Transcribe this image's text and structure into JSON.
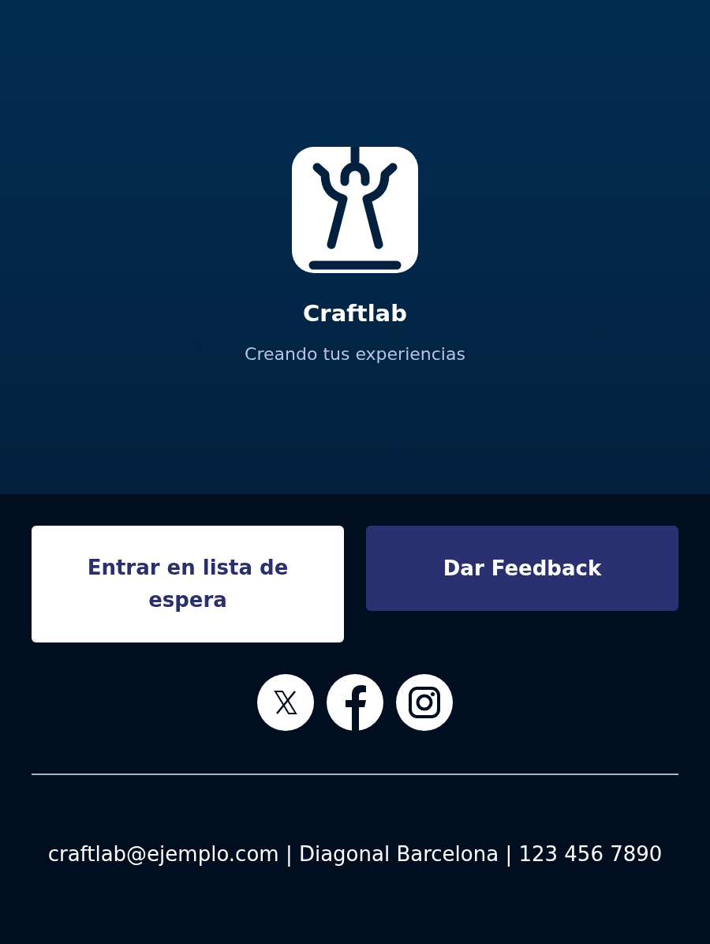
{
  "brand": {
    "name": "Craftlab",
    "tagline": "Creando tus experiencias"
  },
  "buttons": [
    {
      "label": "Entrar en lista de espera",
      "kind": "secondary"
    },
    {
      "label": "Dar Feedback",
      "kind": "primary"
    }
  ],
  "social": [
    {
      "kind": "x"
    },
    {
      "kind": "facebook"
    },
    {
      "kind": "instagram"
    }
  ],
  "contact": "craftlab@ejemplo.com | Diagonal Barcelona | 123 456 7890"
}
